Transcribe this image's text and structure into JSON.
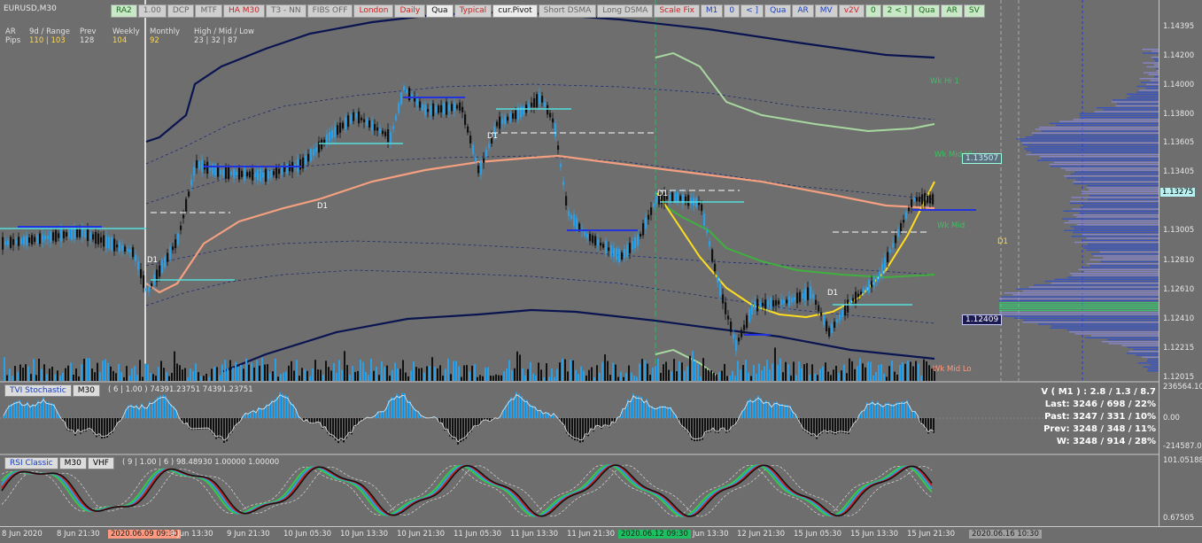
{
  "symbol": "EURUSD,M30",
  "toolbar": [
    {
      "label": "RA2",
      "bg": "#c8e8c8",
      "fg": "#1a6a1a"
    },
    {
      "label": "1.00",
      "bg": "#cfcfcf",
      "fg": "#666666"
    },
    {
      "label": "DCP",
      "bg": "#cfcfcf",
      "fg": "#666666"
    },
    {
      "label": "MTF",
      "bg": "#cfcfcf",
      "fg": "#666666"
    },
    {
      "label": "HA M30",
      "bg": "#cfcfcf",
      "fg": "#cc2222"
    },
    {
      "label": "T3 - NN",
      "bg": "#cfcfcf",
      "fg": "#666666"
    },
    {
      "label": "FIBS OFF",
      "bg": "#cfcfcf",
      "fg": "#666666"
    },
    {
      "label": "London",
      "bg": "#cfcfcf",
      "fg": "#cc2222"
    },
    {
      "label": "Daily",
      "bg": "#cfcfcf",
      "fg": "#cc2222"
    },
    {
      "label": "Qua",
      "bg": "#ececec",
      "fg": "#111111"
    },
    {
      "label": "Typical",
      "bg": "#cfcfcf",
      "fg": "#cc2222"
    },
    {
      "label": "cur.Pivot",
      "bg": "#ececec",
      "fg": "#111111"
    },
    {
      "label": "Short DSMA",
      "bg": "#cfcfcf",
      "fg": "#666666"
    },
    {
      "label": "Long DSMA",
      "bg": "#cfcfcf",
      "fg": "#666666"
    },
    {
      "label": "Scale Fix",
      "bg": "#cfcfcf",
      "fg": "#cc2222"
    },
    {
      "label": "M1",
      "bg": "#cfcfcf",
      "fg": "#1a40c0"
    },
    {
      "label": "0",
      "bg": "#cfcfcf",
      "fg": "#1a40c0"
    },
    {
      "label": "< ]",
      "bg": "#cfcfcf",
      "fg": "#1a40c0"
    },
    {
      "label": "Qua",
      "bg": "#cfcfcf",
      "fg": "#1a40c0"
    },
    {
      "label": "AR",
      "bg": "#cfcfcf",
      "fg": "#1a40c0"
    },
    {
      "label": "MV",
      "bg": "#cfcfcf",
      "fg": "#1a40c0"
    },
    {
      "label": "v2V",
      "bg": "#cfcfcf",
      "fg": "#cc2222"
    },
    {
      "label": "0",
      "bg": "#c8e8c8",
      "fg": "#1a6a1a"
    },
    {
      "label": "2 < ]",
      "bg": "#c8e8c8",
      "fg": "#1a6a1a"
    },
    {
      "label": "Qua",
      "bg": "#c8e8c8",
      "fg": "#1a6a1a"
    },
    {
      "label": "AR",
      "bg": "#c8e8c8",
      "fg": "#1a6a1a"
    },
    {
      "label": "SV",
      "bg": "#c8e8c8",
      "fg": "#1a6a1a"
    }
  ],
  "info": {
    "ar": "AR",
    "pips": "Pips",
    "range_label": "9d / Range",
    "range_value": "110 | 103",
    "prev_label": "Prev",
    "prev_value": "128",
    "weekly_label": "Weekly",
    "weekly_value": "104",
    "monthly_label": "Monthly",
    "monthly_value": "92",
    "hml_label": "High / Mid / Low",
    "hml_value": "23  |  32  |  87"
  },
  "price_ticks": [
    "1.14395",
    "1.14200",
    "1.14000",
    "1.13800",
    "1.13605",
    "1.13405",
    "1.13275",
    "1.13005",
    "1.12810",
    "1.12610",
    "1.12410",
    "1.12215",
    "1.12015"
  ],
  "price_tags": {
    "current": "1.13275",
    "upper_tag": "1.13507",
    "lower_tag": "1.12409"
  },
  "chart_labels": {
    "d1": "D1",
    "wk_mid": "Wk Mid",
    "wk_mid_lo": "Wk Mid Lo",
    "wk_hi": "Wk Hi 1",
    "wk_mid_hi": "Wk Mid Hi"
  },
  "tvi": {
    "title": "TVI Stochastic",
    "tf": "M30",
    "params": "( 6 | 1.00 ) 74391.23751 74391.23751",
    "ticks": [
      "236564.10",
      "0.00",
      "-214587.00"
    ]
  },
  "rsi": {
    "title": "RSI Classic",
    "tf": "M30",
    "extra": "VHF",
    "params": "( 9 | 1.00 | 6 ) 98.48930 1.00000 1.00000",
    "ticks": [
      "101.05188",
      "0.67505"
    ]
  },
  "vstats": {
    "v": "V ( M1 ) : 2.8 / 1.3 / 8.7",
    "last": "Last: 3246 / 698 / 22%",
    "past": "Past: 3247 / 331 / 10%",
    "prev": "Prev: 3248 / 348 / 11%",
    "w": "W: 3248 / 914 / 28%"
  },
  "time_labels": [
    "8 Jun 2020",
    "8 Jun 21:30",
    "2020.06.09 09:30",
    "9 Jun 13:30",
    "9 Jun 21:30",
    "10 Jun 05:30",
    "10 Jun 13:30",
    "10 Jun 21:30",
    "11 Jun 05:30",
    "11 Jun 13:30",
    "11 Jun 21:30",
    "2020.06.12 09:30",
    "Jun 13:30",
    "12 Jun 21:30",
    "15 Jun 05:30",
    "15 Jun 13:30",
    "15 Jun 21:30",
    "2020.06.16 10:30"
  ],
  "colors": {
    "bull": "#2aa0e8",
    "bear": "#111111",
    "ema": "#f4a080",
    "band": "#0a1450",
    "parabola": "#ffdd22",
    "green": "#40b040",
    "hl1": "#ff9a80",
    "hl2": "#1cc060",
    "hl3": "#909090"
  }
}
